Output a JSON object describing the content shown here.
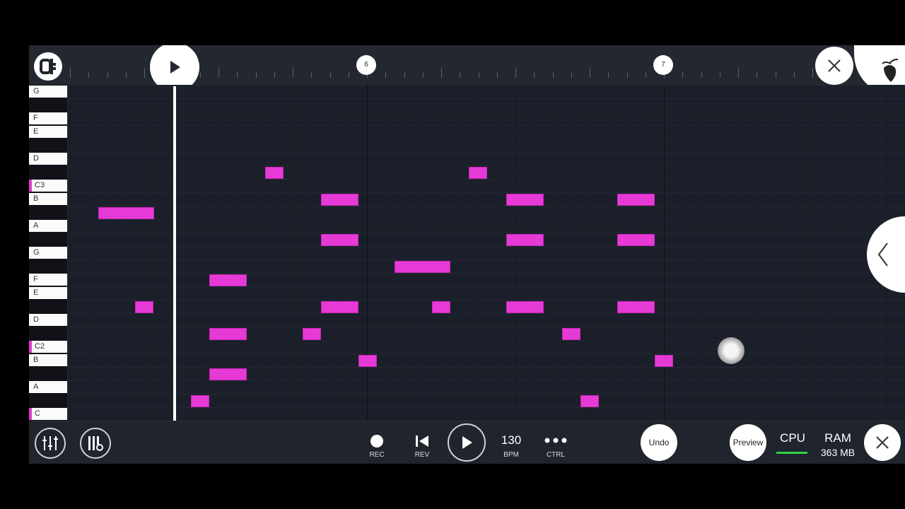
{
  "ruler": {
    "bar6": "6",
    "bar7": "7"
  },
  "keys": [
    "G",
    "F",
    "E",
    "D",
    "C3",
    "B",
    "A",
    "G",
    "F",
    "E",
    "D",
    "C2",
    "B",
    "A",
    "C"
  ],
  "transport": {
    "rec": "REC",
    "rev": "REV",
    "tempo": "130",
    "tempo_unit": "BPM",
    "ctrl": "CTRL"
  },
  "actions": {
    "undo": "Undo",
    "preview": "Preview"
  },
  "stats": {
    "cpu": "CPU",
    "ram_label": "RAM",
    "ram_value": "363 MB"
  },
  "icons": [
    "logo-icon",
    "play-icon",
    "close-icon",
    "fl-fruit-icon",
    "chevron-left-icon",
    "mixer-icon",
    "piano-settings-icon",
    "record-icon",
    "rewind-icon",
    "more-icon"
  ],
  "colors": {
    "note": "#e63ad6",
    "background": "#1a1f29",
    "cpu_meter": "#2fd24a"
  }
}
